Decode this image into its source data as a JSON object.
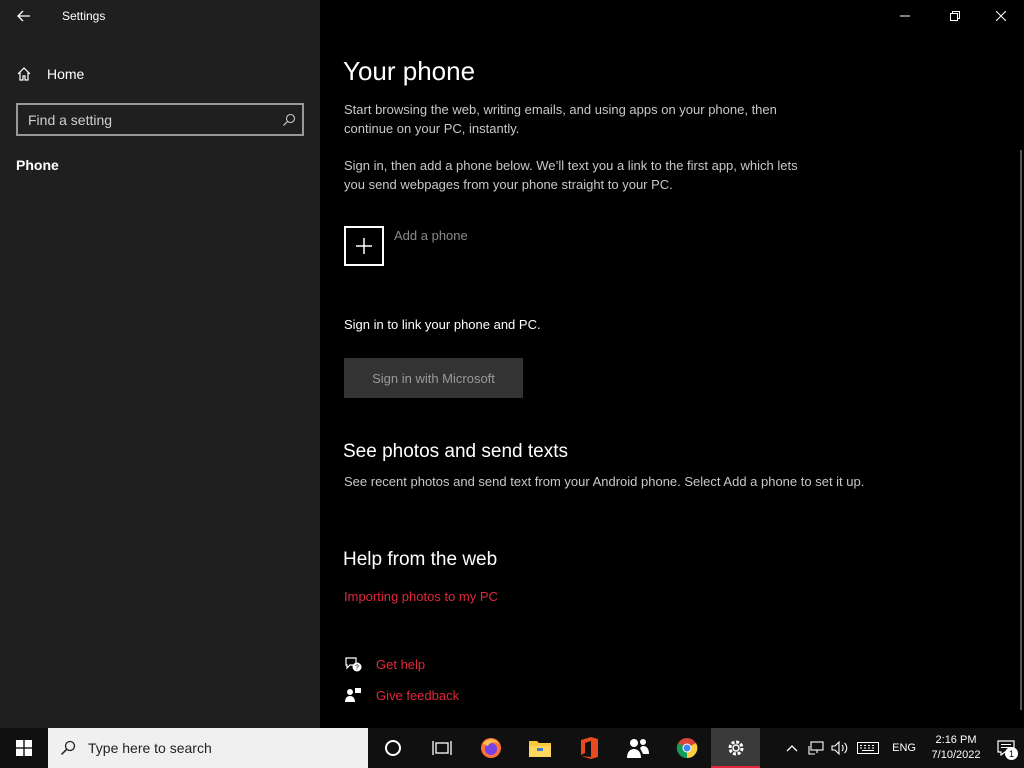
{
  "window": {
    "title": "Settings"
  },
  "sidebar": {
    "home_label": "Home",
    "search_placeholder": "Find a setting",
    "current_item": "Phone"
  },
  "main": {
    "title": "Your phone",
    "intro": "Start browsing the web, writing emails, and using apps on your phone, then continue on your PC, instantly.",
    "signin_note": "Sign in, then add a phone below. We’ll text you a link to the first app, which lets you send webpages from your phone straight to your PC.",
    "add_phone_label": "Add a phone",
    "signin_prompt": "Sign in to link your phone and PC.",
    "signin_button": "Sign in with Microsoft",
    "photos_section": {
      "title": "See photos and send texts",
      "description": "See recent photos and send text from your Android phone. Select Add a phone to set it up."
    },
    "help_section": {
      "title": "Help from the web",
      "link": "Importing photos to my PC"
    },
    "get_help": "Get help",
    "give_feedback": "Give feedback"
  },
  "taskbar": {
    "search_placeholder": "Type here to search",
    "apps": [
      "cortana-icon",
      "task-view-icon",
      "firefox-icon",
      "file-explorer-icon",
      "office-icon",
      "people-icon",
      "chrome-icon",
      "settings-icon"
    ],
    "active_app": "settings-icon",
    "language": "ENG",
    "time": "2:16 PM",
    "date": "7/10/2022",
    "notification_count": "1"
  },
  "colors": {
    "accent": "#e3263b",
    "sidebar_bg": "#1f1f1f",
    "main_bg": "#000000"
  }
}
